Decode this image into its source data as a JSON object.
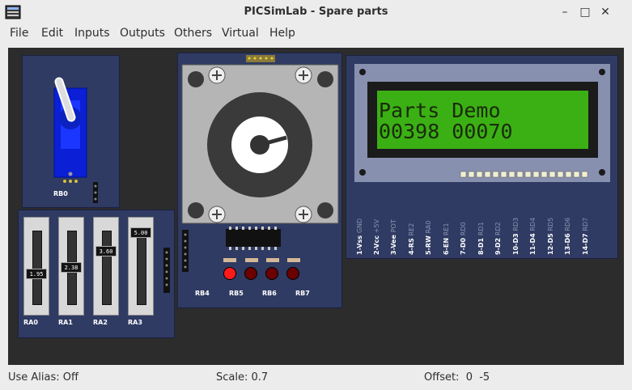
{
  "window": {
    "title": "PICSimLab - Spare parts",
    "minimize": "–",
    "maximize": "□",
    "close": "✕"
  },
  "menu": [
    "File",
    "Edit",
    "Inputs",
    "Outputs",
    "Others",
    "Virtual",
    "Help"
  ],
  "servo": {
    "label": "RB0"
  },
  "sliders": [
    {
      "label": "RA0",
      "value": "1.95",
      "level": 0.35
    },
    {
      "label": "RA1",
      "value": "2.38",
      "level": 0.45
    },
    {
      "label": "RA2",
      "value": "3.60",
      "level": 0.7
    },
    {
      "label": "RA3",
      "value": "5.00",
      "level": 1.0
    }
  ],
  "stepper": {
    "pins": [
      "RB4",
      "RB5",
      "RB6",
      "RB7"
    ],
    "leds_lit": [
      true,
      false,
      false,
      false
    ],
    "colors": {
      "led_on": "#ff1a1a",
      "led_off": "#6a0000"
    }
  },
  "lcd": {
    "line1": "Parts Demo",
    "line2": "00398   00070",
    "pins": [
      {
        "name": "1-Vss",
        "sub": "GND"
      },
      {
        "name": "2-Vcc",
        "sub": "+5V"
      },
      {
        "name": "3-Vee",
        "sub": "POT"
      },
      {
        "name": "4-RS",
        "sub": "RE2"
      },
      {
        "name": "5-RW",
        "sub": "RA0"
      },
      {
        "name": "6-EN",
        "sub": "RE1"
      },
      {
        "name": "7-D0",
        "sub": "RD0"
      },
      {
        "name": "8-D1",
        "sub": "RD1"
      },
      {
        "name": "9-D2",
        "sub": "RD2"
      },
      {
        "name": "10-D3",
        "sub": "RD3"
      },
      {
        "name": "11-D4",
        "sub": "RD4"
      },
      {
        "name": "12-D5",
        "sub": "RD5"
      },
      {
        "name": "13-D6",
        "sub": "RD6"
      },
      {
        "name": "14-D7",
        "sub": "RD7"
      }
    ],
    "colors": {
      "screen": "#3bb014",
      "bezel": "#1b1b1b"
    }
  },
  "status": {
    "alias": "Use Alias: Off",
    "scale": "Scale: 0.7",
    "offset": "Offset:  0  -5"
  }
}
